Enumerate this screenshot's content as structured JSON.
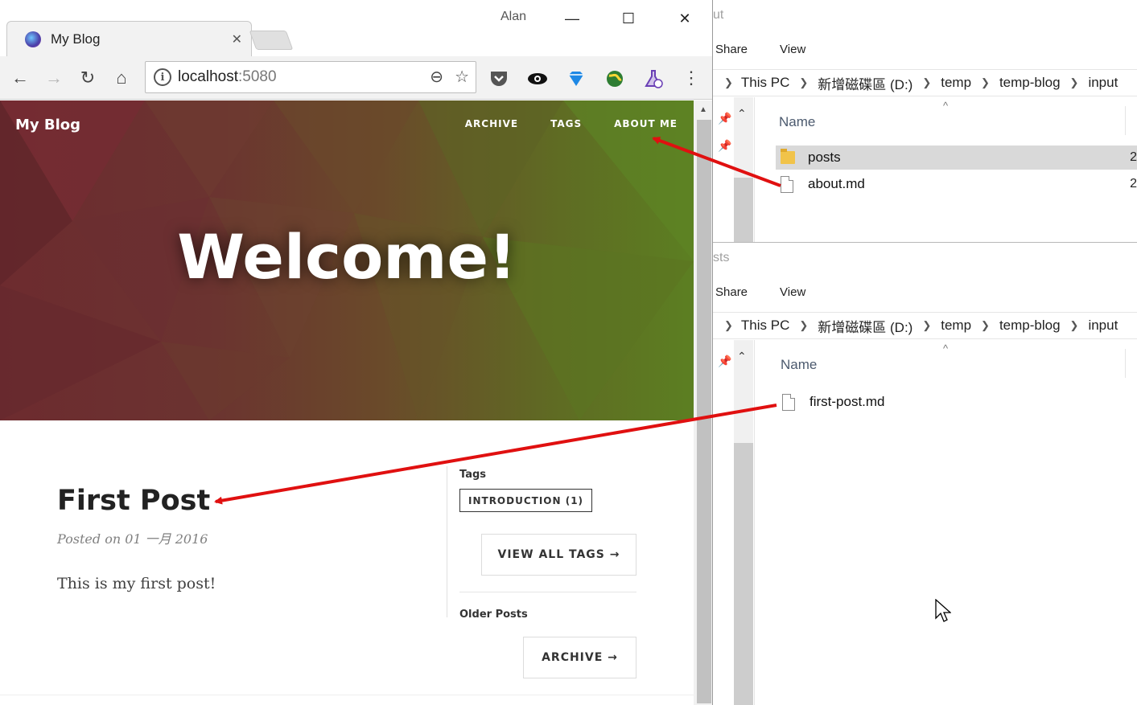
{
  "explorer_top": {
    "title_fragment": "ut",
    "ribbon": [
      "Share",
      "View"
    ],
    "breadcrumb": [
      "This PC",
      "新增磁碟區 (D:)",
      "temp",
      "temp-blog",
      "input"
    ],
    "column_name": "Name",
    "files": [
      {
        "name": "posts",
        "type": "folder",
        "selected": true,
        "trail": "2"
      },
      {
        "name": "about.md",
        "type": "file",
        "selected": false,
        "trail": "2"
      }
    ]
  },
  "explorer_bottom": {
    "title_fragment": "sts",
    "ribbon": [
      "Share",
      "View"
    ],
    "breadcrumb": [
      "This PC",
      "新增磁碟區 (D:)",
      "temp",
      "temp-blog",
      "input"
    ],
    "column_name": "Name",
    "files": [
      {
        "name": "first-post.md",
        "type": "file",
        "selected": false
      }
    ]
  },
  "browser": {
    "tab_title": "My Blog",
    "user": "Alan",
    "url_host": "localhost",
    "url_port": ":5080",
    "extensions": [
      "pocket-icon",
      "eye-icon",
      "diamond-icon",
      "globe-icon",
      "flask-icon"
    ]
  },
  "page": {
    "brand": "My Blog",
    "nav": [
      "ARCHIVE",
      "TAGS",
      "ABOUT ME"
    ],
    "hero_title": "Welcome!",
    "post": {
      "title": "First Post",
      "meta": "Posted on 01 一月 2016",
      "body": "This is my first post!"
    },
    "sidebar": {
      "tags_heading": "Tags",
      "tag_chip": "INTRODUCTION (1)",
      "view_all_tags": "VIEW ALL TAGS →",
      "older_heading": "Older Posts",
      "archive_button": "ARCHIVE →"
    }
  },
  "colors": {
    "arrow": "#e01010",
    "hero_left": "#6d2b2f",
    "hero_right": "#5c7f22"
  }
}
